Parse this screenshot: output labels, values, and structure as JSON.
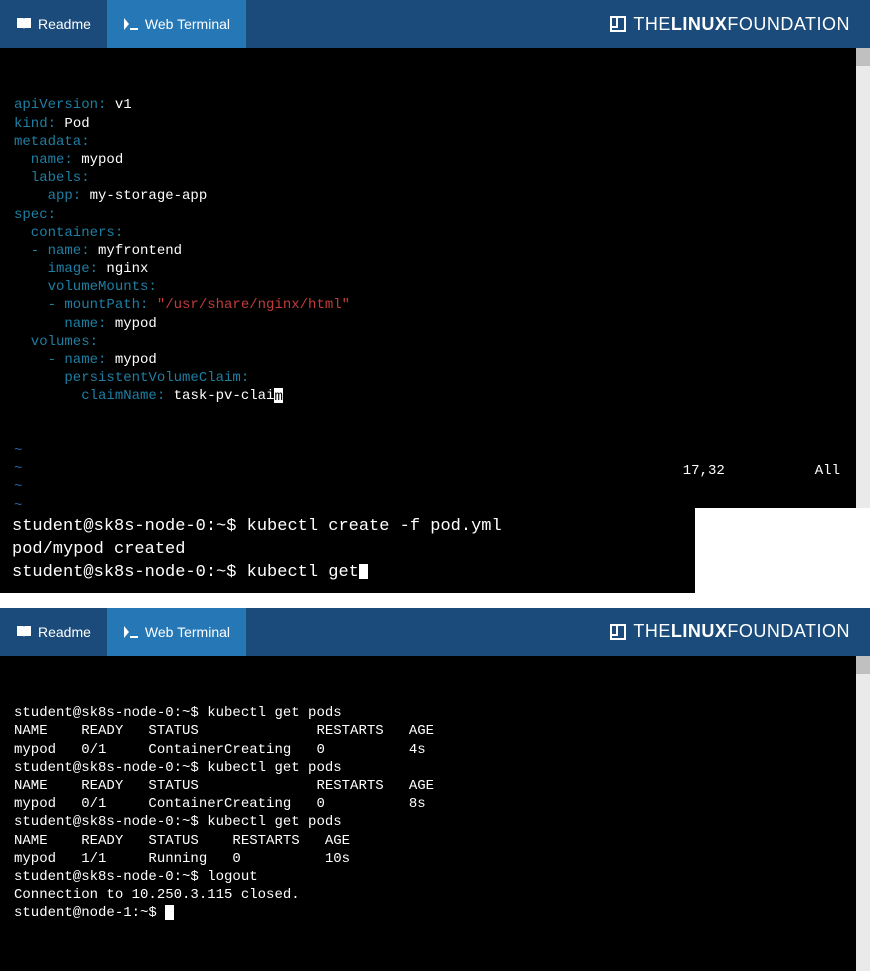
{
  "header": {
    "tabs": {
      "readme": "Readme",
      "web_terminal": "Web Terminal"
    },
    "logo_left": "THE",
    "logo_bold": "LINUX",
    "logo_right": "FOUNDATION"
  },
  "pane1": {
    "yaml": [
      {
        "k": "apiVersion:",
        "v": " v1",
        "t": "w"
      },
      {
        "k": "kind:",
        "v": " Pod",
        "t": "w"
      },
      {
        "k": "metadata:",
        "v": "",
        "t": ""
      },
      {
        "k": "  name:",
        "v": " mypod",
        "t": "w"
      },
      {
        "k": "  labels:",
        "v": "",
        "t": ""
      },
      {
        "k": "    app:",
        "v": " my-storage-app",
        "t": "w"
      },
      {
        "k": "spec:",
        "v": "",
        "t": ""
      },
      {
        "k": "  containers:",
        "v": "",
        "t": ""
      },
      {
        "k": "  - name:",
        "v": " myfrontend",
        "t": "w"
      },
      {
        "k": "    image:",
        "v": " nginx",
        "t": "w"
      },
      {
        "k": "    volumeMounts:",
        "v": "",
        "t": ""
      },
      {
        "k": "    - mountPath:",
        "v": " \"/usr/share/nginx/html\"",
        "t": "r"
      },
      {
        "k": "      name:",
        "v": " mypod",
        "t": "w"
      },
      {
        "k": "  volumes:",
        "v": "",
        "t": ""
      },
      {
        "k": "    - name:",
        "v": " mypod",
        "t": "w"
      },
      {
        "k": "      persistentVolumeClaim:",
        "v": "",
        "t": ""
      },
      {
        "k": "        claimName:",
        "v": " task-pv-clai",
        "t": "w",
        "cursor": "m"
      }
    ],
    "tildes": [
      "~",
      "~",
      "~",
      "~",
      "~",
      "~",
      "~",
      "~"
    ],
    "status_pos": "17,32",
    "status_all": "All"
  },
  "pane2": {
    "line1_prompt": "student@sk8s-node-0:~$ ",
    "line1_cmd": "kubectl create -f pod.yml",
    "line2": "pod/mypod created",
    "line3_prompt": "student@sk8s-node-0:~$ ",
    "line3_cmd": "kubectl get"
  },
  "pane3": {
    "lines": [
      "student@sk8s-node-0:~$ kubectl get pods",
      "NAME    READY   STATUS              RESTARTS   AGE",
      "mypod   0/1     ContainerCreating   0          4s",
      "student@sk8s-node-0:~$ kubectl get pods",
      "NAME    READY   STATUS              RESTARTS   AGE",
      "mypod   0/1     ContainerCreating   0          8s",
      "student@sk8s-node-0:~$ kubectl get pods",
      "NAME    READY   STATUS    RESTARTS   AGE",
      "mypod   1/1     Running   0          10s",
      "student@sk8s-node-0:~$ logout",
      "Connection to 10.250.3.115 closed.",
      "student@node-1:~$ "
    ]
  }
}
